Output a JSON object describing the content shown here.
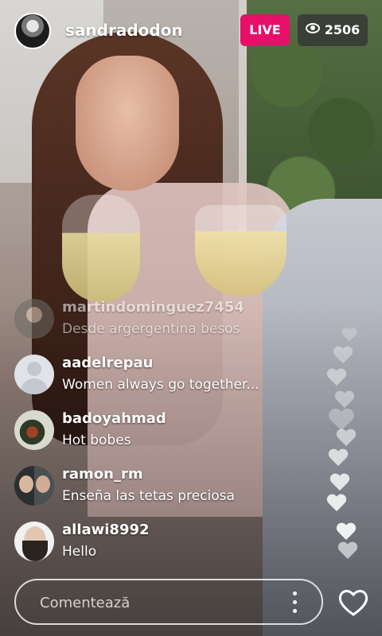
{
  "header": {
    "username": "sandradodon",
    "live_label": "LIVE",
    "viewer_count": "2506",
    "icon": "eye-icon"
  },
  "comments": [
    {
      "user": "martindominguez7454",
      "text": "Desde argergentina besos",
      "faded": true
    },
    {
      "user": "aadelrepau",
      "text": "Women always go together..."
    },
    {
      "user": "badoyahmad",
      "text": "Hot bobes"
    },
    {
      "user": "ramon_rm",
      "text": "Enseña las tetas preciosa"
    },
    {
      "user": "allawi8992",
      "text": "Hello"
    }
  ],
  "composer": {
    "placeholder": "Comentează",
    "more_icon": "more-vertical-icon",
    "like_icon": "heart-outline-icon"
  },
  "colors": {
    "live": "#e6106a",
    "viewer_badge": "#323232"
  }
}
